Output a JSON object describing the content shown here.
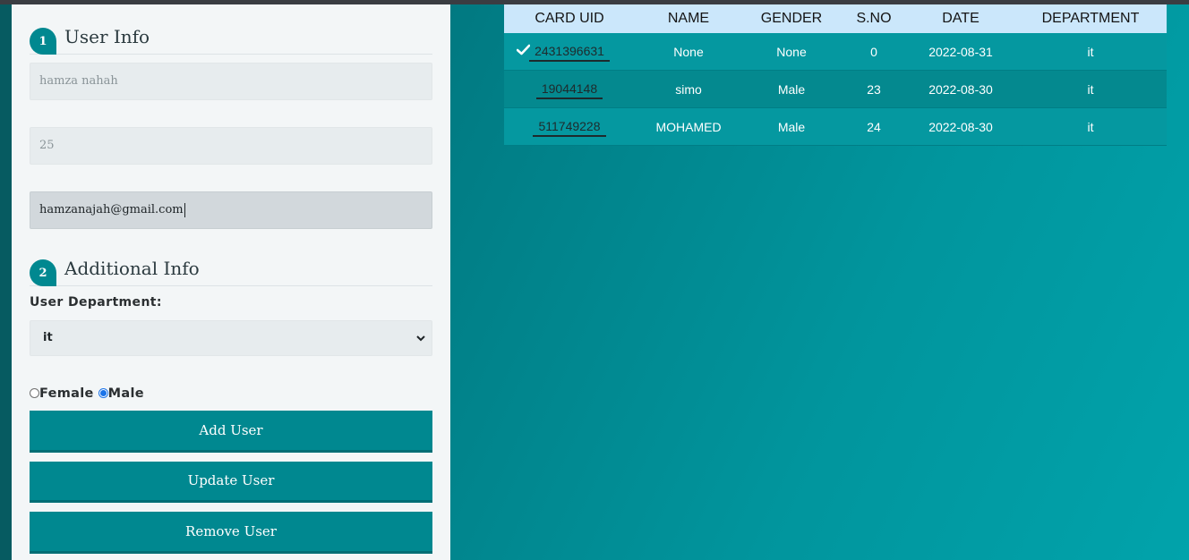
{
  "user_info": {
    "step": "1",
    "title": "User Info",
    "name_value": "hamza nahah",
    "age_value": "25",
    "email_value": "hamzanajah@gmail.com"
  },
  "additional_info": {
    "step": "2",
    "title": "Additional Info",
    "department_label": "User Department:",
    "department_selected": "it",
    "gender_options": [
      "Female",
      "Male"
    ],
    "gender_selected": "Male"
  },
  "buttons": {
    "add": "Add User",
    "update": "Update User",
    "remove": "Remove User"
  },
  "table": {
    "headers": [
      "CARD UID",
      "NAME",
      "GENDER",
      "S.NO",
      "DATE",
      "DEPARTMENT"
    ],
    "rows": [
      {
        "card_uid": "2431396631",
        "name": "None",
        "gender": "None",
        "sno": "0",
        "date": "2022-08-31",
        "department": "it",
        "selected": true
      },
      {
        "card_uid": "19044148",
        "name": "simo",
        "gender": "Male",
        "sno": "23",
        "date": "2022-08-30",
        "department": "it",
        "selected": false
      },
      {
        "card_uid": "511749228",
        "name": "MOHAMED",
        "gender": "Male",
        "sno": "24",
        "date": "2022-08-30",
        "department": "it",
        "selected": false
      }
    ]
  },
  "colors": {
    "accent": "#008890",
    "panel": "#f3f6f7",
    "table_header": "#cbe7fb",
    "radio_selected": "#1a73e8"
  }
}
